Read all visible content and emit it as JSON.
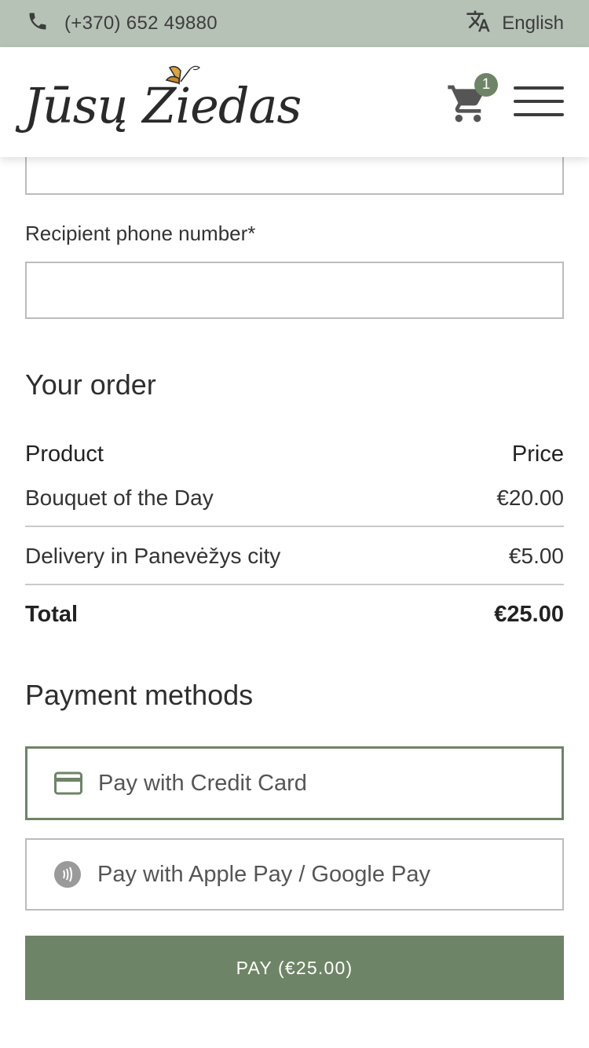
{
  "topbar": {
    "phone": "(+370) 652 49880",
    "language": "English"
  },
  "header": {
    "logo_text": "Jūsų Ziedas",
    "cart_count": "1"
  },
  "form": {
    "recipient_phone_label": "Recipient phone number*",
    "recipient_phone_value": ""
  },
  "order": {
    "title": "Your order",
    "col_product": "Product",
    "col_price": "Price",
    "items": [
      {
        "name": "Bouquet of the Day",
        "price": "€20.00"
      },
      {
        "name": "Delivery in Panevėžys city",
        "price": "€5.00"
      }
    ],
    "total_label": "Total",
    "total_value": "€25.00"
  },
  "payment": {
    "title": "Payment methods",
    "options": [
      {
        "label": "Pay with Credit Card",
        "icon": "credit-card-icon",
        "selected": true
      },
      {
        "label": "Pay with Apple Pay / Google Pay",
        "icon": "contactless-icon",
        "selected": false
      }
    ],
    "pay_button": "PAY (€25.00)"
  },
  "colors": {
    "accent": "#6e8466",
    "topbar": "#b6c2b6"
  }
}
